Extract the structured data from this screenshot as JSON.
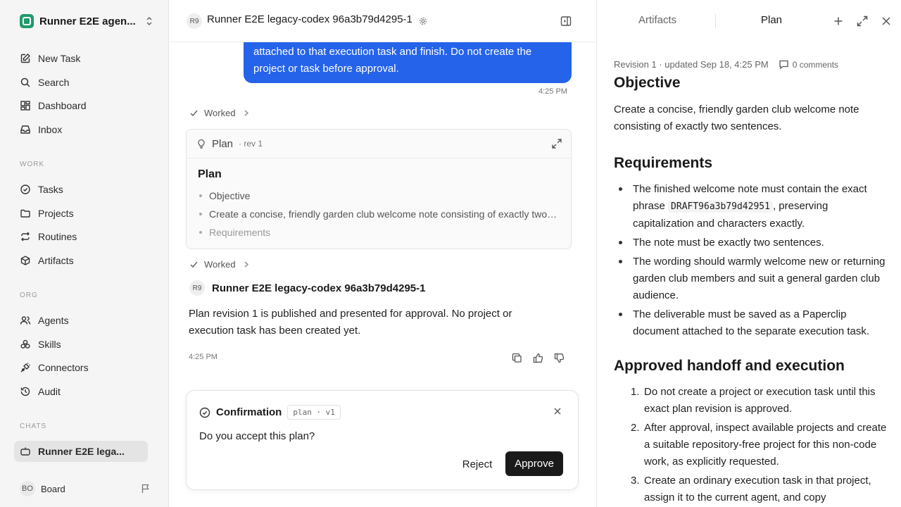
{
  "sidebar": {
    "workspace_name": "Runner E2E agen...",
    "top_items": [
      {
        "label": "New Task",
        "icon": "pencil-square-icon"
      },
      {
        "label": "Search",
        "icon": "search-icon"
      },
      {
        "label": "Dashboard",
        "icon": "dashboard-grid-icon"
      },
      {
        "label": "Inbox",
        "icon": "inbox-icon"
      }
    ],
    "work_section": "WORK",
    "work_items": [
      {
        "label": "Tasks",
        "icon": "check-circle-icon"
      },
      {
        "label": "Projects",
        "icon": "folder-icon"
      },
      {
        "label": "Routines",
        "icon": "repeat-icon"
      },
      {
        "label": "Artifacts",
        "icon": "cube-icon"
      }
    ],
    "org_section": "ORG",
    "org_items": [
      {
        "label": "Agents",
        "icon": "users-icon"
      },
      {
        "label": "Skills",
        "icon": "skills-icon"
      },
      {
        "label": "Connectors",
        "icon": "plug-icon"
      },
      {
        "label": "Audit",
        "icon": "history-icon"
      }
    ],
    "chats_section": "CHATS",
    "chats": [
      {
        "label": "Runner E2E lega...",
        "icon": "chat-bot-icon",
        "active": true
      }
    ],
    "board": {
      "initials": "BO",
      "label": "Board"
    }
  },
  "chat": {
    "header_badge": "R9",
    "header_title": "Runner E2E legacy-codex 96a3b79d4295-1",
    "user_message": "attached to that execution task and finish. Do not create the project or task before approval.",
    "user_time": "4:25 PM",
    "worked_label_1": "Worked",
    "plan_card": {
      "label": "Plan",
      "rev": "· rev 1",
      "title": "Plan",
      "items": [
        "Objective",
        "Create a concise, friendly garden club welcome note consisting of exactly two sentences.",
        "Requirements"
      ]
    },
    "worked_label_2": "Worked",
    "agent_badge": "R9",
    "agent_name": "Runner E2E legacy-codex 96a3b79d4295-1",
    "agent_message": "Plan revision 1 is published and presented for approval. No project or execution task has been created yet.",
    "agent_time": "4:25 PM",
    "confirmation": {
      "title": "Confirmation",
      "tag": "plan · v1",
      "question": "Do you accept this plan?",
      "reject_label": "Reject",
      "approve_label": "Approve"
    }
  },
  "panel": {
    "tab_artifacts": "Artifacts",
    "tab_plan": "Plan",
    "meta": "Revision 1 · updated Sep 18, 4:25 PM",
    "comments": "0 comments",
    "objective_heading": "Objective",
    "objective_text": "Create a concise, friendly garden club welcome note consisting of exactly two sentences.",
    "requirements_heading": "Requirements",
    "req_1_before": "The finished welcome note must contain the exact phrase",
    "req_1_code": "DRAFT96a3b79d42951",
    "req_1_after": ", preserving capitalization and characters exactly.",
    "req_2": "The note must be exactly two sentences.",
    "req_3": "The wording should warmly welcome new or returning garden club members and suit a general garden club audience.",
    "req_4": "The deliverable must be saved as a Paperclip document attached to the separate execution task.",
    "handoff_heading": "Approved handoff and execution",
    "steps": [
      {
        "num": "1.",
        "text": "Do not create a project or execution task until this exact plan revision is approved."
      },
      {
        "num": "2.",
        "text": "After approval, inspect available projects and create a suitable repository-free project for this non-code work, as explicitly requested."
      },
      {
        "num": "3.",
        "text": "Create an ordinary execution task in that project, assign it to the current agent, and copy"
      }
    ]
  },
  "colors": {
    "accent_blue": "#2563eb",
    "approve_bg": "#1a1a1a",
    "brand_green": "#1e9a6b"
  }
}
